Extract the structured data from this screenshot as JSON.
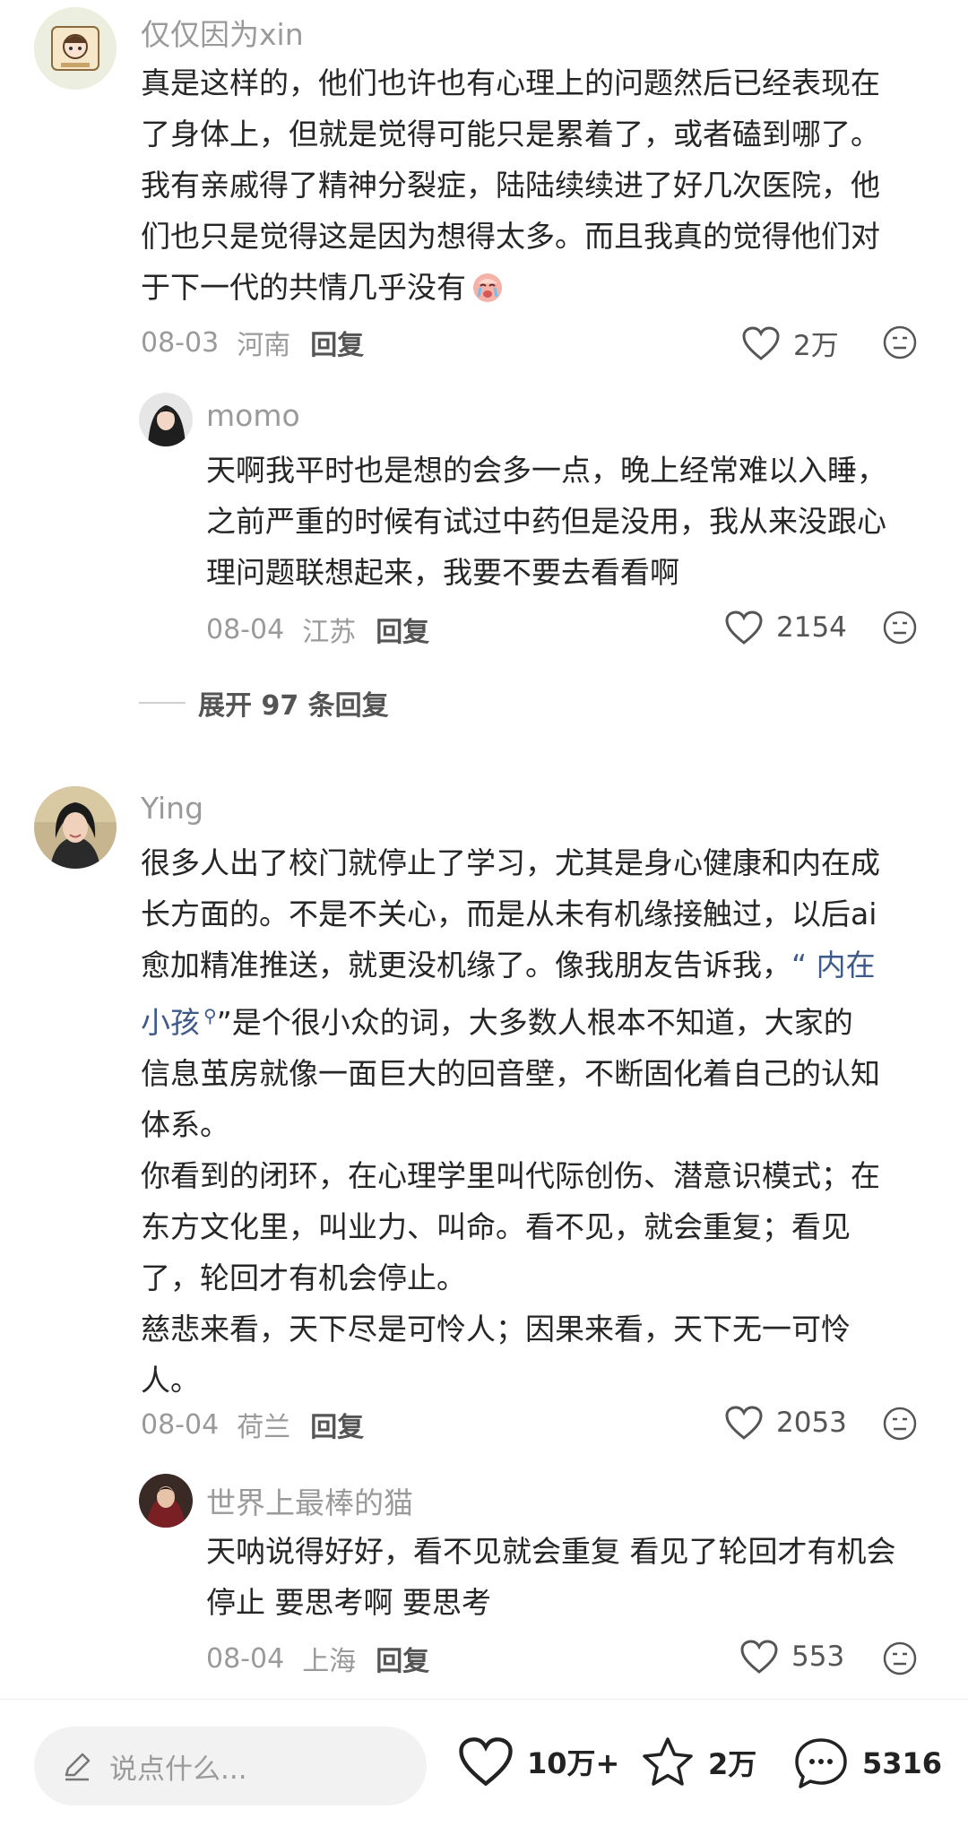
{
  "comments": [
    {
      "username": "仅仅因为xin",
      "lines": [
        "真是这样的，他们也许也有心理上的问题然后已经表现在",
        "了身体上，但就是觉得可能只是累着了，或者磕到哪了。",
        "我有亲戚得了精神分裂症，陆陆续续进了好几次医院，他",
        "们也只是觉得这是因为想得太多。而且我真的觉得他们对",
        "于下一代的共情几乎没有"
      ],
      "date": "08-03",
      "location": "河南",
      "reply_label": "回复",
      "likes": "2万"
    },
    {
      "username": "momo",
      "lines": [
        "天啊我平时也是想的会多一点，晚上经常难以入睡，",
        "之前严重的时候有试过中药但是没用，我从来没跟心",
        "理问题联想起来，我要不要去看看啊"
      ],
      "date": "08-04",
      "location": "江苏",
      "reply_label": "回复",
      "likes": "2154"
    },
    {
      "username": "Ying",
      "lines": [
        "很多人出了校门就停止了学习，尤其是身心健康和内在成",
        "长方面的。不是不关心，而是从未有机缘接触过，以后ai",
        "愈加精准推送，就更没机缘了。像我朋友告诉我，",
        "”是个很小众的词，大多数人根本不知道，大家的",
        "信息茧房就像一面巨大的回音壁，不断固化着自己的认知",
        "体系。",
        "你看到的闭环，在心理学里叫代际创伤、潜意识模式；在",
        "东方文化里，叫业力、叫命。看不见，就会重复；看见",
        "了，轮回才有机会停止。",
        "慈悲来看，天下尽是可怜人；因果来看，天下无一可怜",
        "人。"
      ],
      "highlight_a": "“ 内在",
      "highlight_b": "小孩",
      "date": "08-04",
      "location": "荷兰",
      "reply_label": "回复",
      "likes": "2053"
    },
    {
      "username": "世界上最棒的猫",
      "lines": [
        "天呐说得好好，看不见就会重复 看见了轮回才有机会",
        "停止 要思考啊 要思考"
      ],
      "date": "08-04",
      "location": "上海",
      "reply_label": "回复",
      "likes": "553"
    }
  ],
  "expand_replies": "展开 97 条回复",
  "bottom_bar": {
    "input_placeholder": "说点什么...",
    "likes": "10万+",
    "favorites": "2万",
    "comments": "5316"
  },
  "icons": {
    "edit": "pencil-icon",
    "like": "heart-icon",
    "favorite": "star-icon",
    "comment": "chat-bubble-icon",
    "dislike": "meh-face-icon"
  }
}
